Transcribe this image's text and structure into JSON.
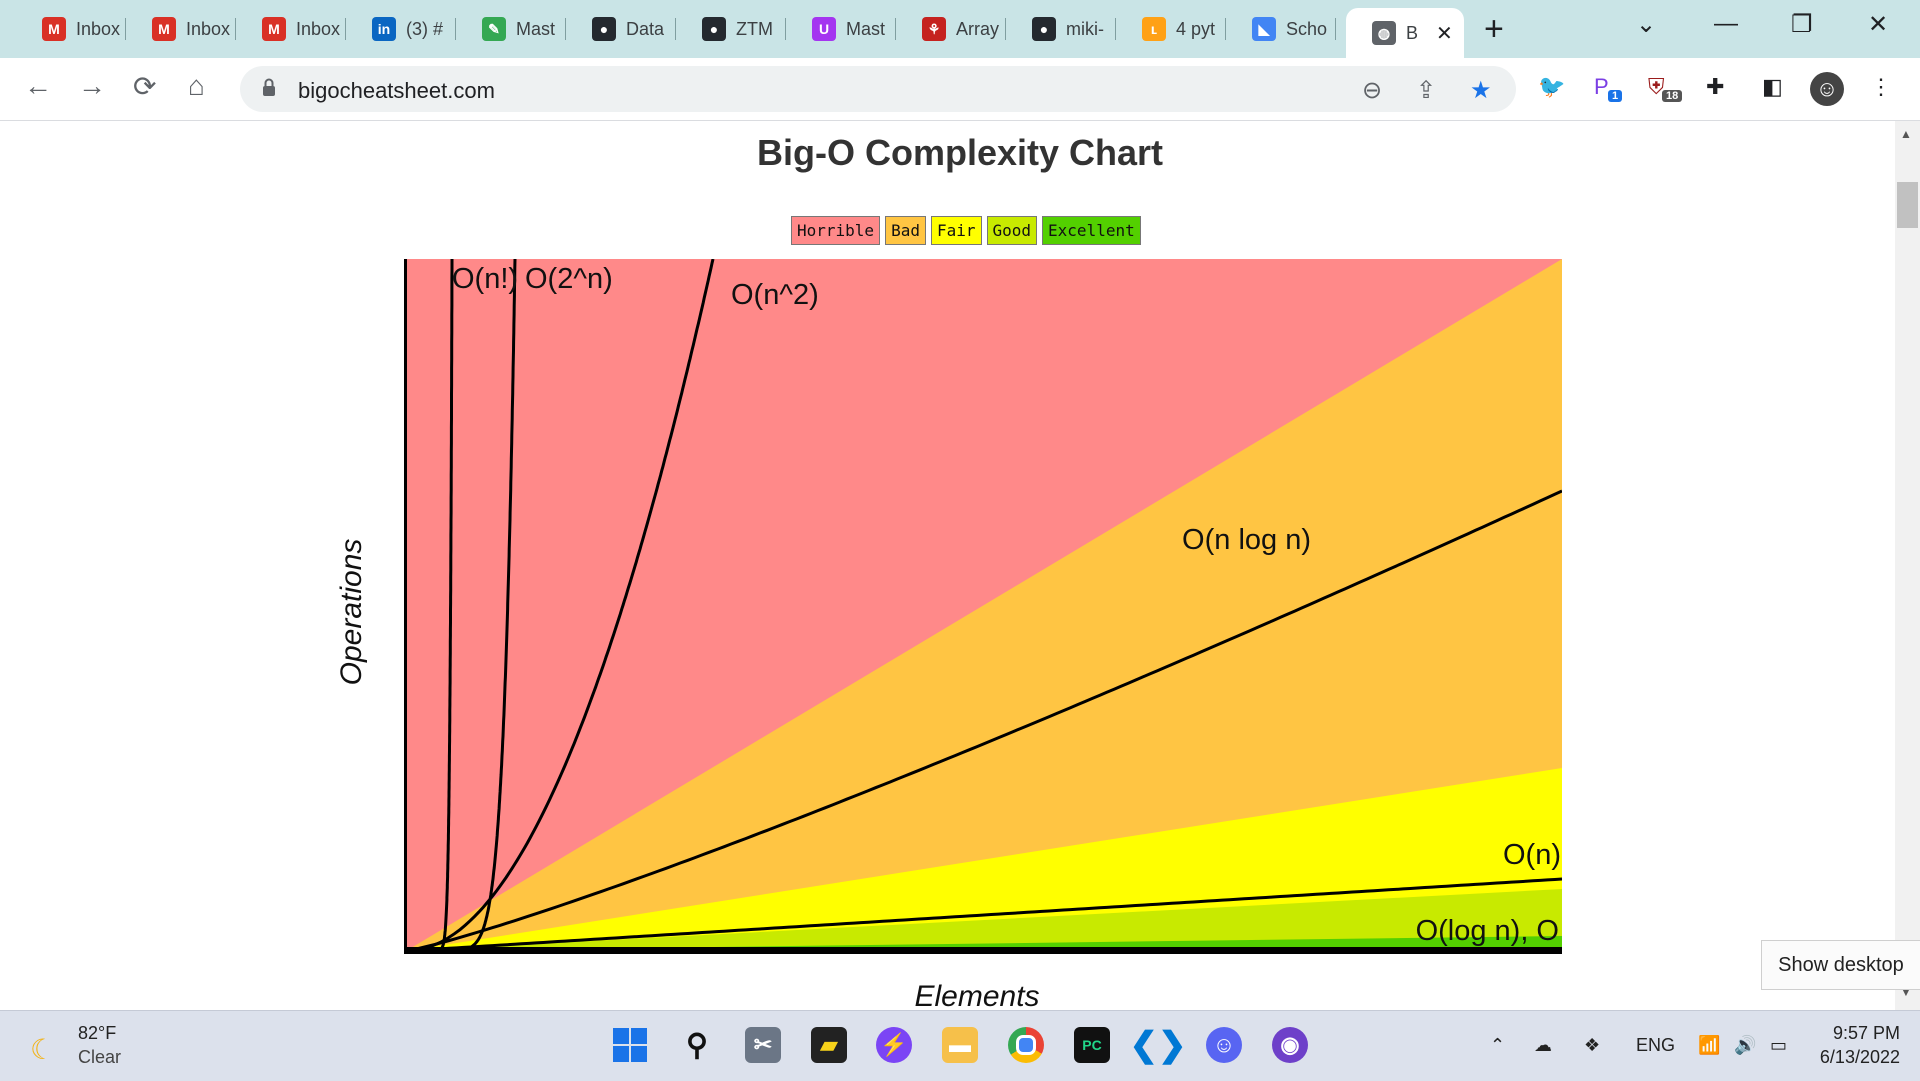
{
  "browser": {
    "tabs": [
      {
        "label": "Inbox",
        "icon": "gmail-icon",
        "color": "#d93025"
      },
      {
        "label": "Inbox",
        "icon": "gmail-icon",
        "color": "#d93025"
      },
      {
        "label": "Inbox",
        "icon": "gmail-icon",
        "color": "#d93025"
      },
      {
        "label": "(3) #",
        "icon": "linkedin-icon",
        "color": "#0a66c2"
      },
      {
        "label": "Mast",
        "icon": "mastery-icon",
        "color": "#34a853"
      },
      {
        "label": "Data",
        "icon": "github-icon",
        "color": "#24292f"
      },
      {
        "label": "ZTM",
        "icon": "github-icon",
        "color": "#24292f"
      },
      {
        "label": "Mast",
        "icon": "udemy-icon",
        "color": "#a435f0"
      },
      {
        "label": "Array",
        "icon": "figure-icon",
        "color": "#c5221f"
      },
      {
        "label": "miki-",
        "icon": "github-icon",
        "color": "#24292f"
      },
      {
        "label": "4 pyt",
        "icon": "leetcode-icon",
        "color": "#ffa116"
      },
      {
        "label": "Scho",
        "icon": "school-icon",
        "color": "#4285f4"
      },
      {
        "label": "B",
        "icon": "globe-icon",
        "color": "#5f6368"
      }
    ],
    "new_tab_label": "+",
    "url": "bigocheatsheet.com",
    "extensions": [
      {
        "icon": "bird-extension-icon"
      },
      {
        "icon": "p-extension-icon",
        "badge": "1"
      },
      {
        "icon": "ublock-extension-icon",
        "badge": "18"
      },
      {
        "icon": "puzzle-extensions-icon"
      },
      {
        "icon": "side-panel-icon"
      },
      {
        "icon": "profile-avatar"
      },
      {
        "icon": "menu-kebab-icon"
      }
    ]
  },
  "page": {
    "title": "Big-O Complexity Chart",
    "legend": [
      {
        "label": "Horrible",
        "color": "#ff8989"
      },
      {
        "label": "Bad",
        "color": "#ffc543"
      },
      {
        "label": "Fair",
        "color": "#ffff00"
      },
      {
        "label": "Good",
        "color": "#c8ea00"
      },
      {
        "label": "Excellent",
        "color": "#53d000"
      }
    ]
  },
  "chart_data": {
    "type": "line",
    "title": "Big-O Complexity Chart",
    "xlabel": "Elements",
    "ylabel": "Operations",
    "series": [
      {
        "name": "O(n!)"
      },
      {
        "name": "O(2^n)"
      },
      {
        "name": "O(n^2)"
      },
      {
        "name": "O(n log n)"
      },
      {
        "name": "O(n)"
      },
      {
        "name": "O(log n), O"
      }
    ]
  },
  "tooltip": "Show desktop",
  "taskbar": {
    "weather_temp": "82°F",
    "weather_cond": "Clear",
    "language": "ENG",
    "time": "9:57 PM",
    "date": "6/13/2022"
  }
}
